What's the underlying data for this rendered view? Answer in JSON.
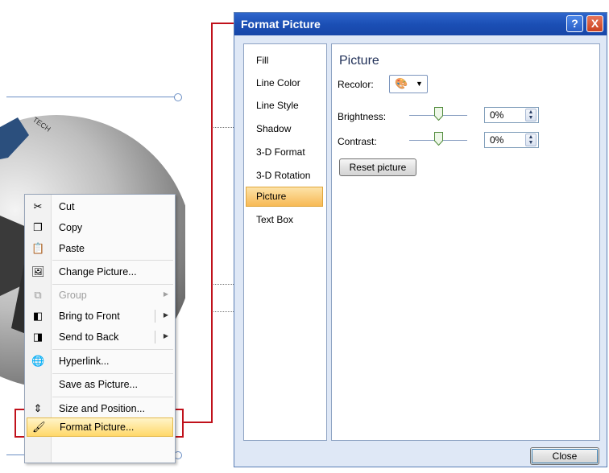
{
  "context_menu": {
    "items": [
      {
        "label": "Cut",
        "icon": "scissors-icon",
        "disabled": false
      },
      {
        "label": "Copy",
        "icon": "copy-icon",
        "disabled": false
      },
      {
        "label": "Paste",
        "icon": "paste-icon",
        "disabled": false
      },
      {
        "label": "Change Picture...",
        "icon": "change-picture-icon",
        "disabled": false
      },
      {
        "label": "Group",
        "icon": "group-icon",
        "disabled": true,
        "submenu": true
      },
      {
        "label": "Bring to Front",
        "icon": "bring-to-front-icon",
        "disabled": false,
        "submenu": true
      },
      {
        "label": "Send to Back",
        "icon": "send-to-back-icon",
        "disabled": false,
        "submenu": true
      },
      {
        "label": "Hyperlink...",
        "icon": "hyperlink-icon",
        "disabled": false
      },
      {
        "label": "Save as Picture...",
        "icon": "",
        "disabled": false
      },
      {
        "label": "Size and Position...",
        "icon": "size-position-icon",
        "disabled": false
      },
      {
        "label": "Format Picture...",
        "icon": "format-picture-icon",
        "disabled": false,
        "highlighted": true
      }
    ]
  },
  "dialog": {
    "title": "Format Picture",
    "help_label": "?",
    "close_x_label": "X",
    "nav": [
      {
        "label": "Fill"
      },
      {
        "label": "Line Color"
      },
      {
        "label": "Line Style"
      },
      {
        "label": "Shadow"
      },
      {
        "label": "3-D Format"
      },
      {
        "label": "3-D Rotation"
      },
      {
        "label": "Picture",
        "selected": true
      },
      {
        "label": "Text Box"
      }
    ],
    "section_title": "Picture",
    "recolor_label": "Recolor:",
    "brightness_label": "Brightness:",
    "brightness_value": "0%",
    "brightness_level": 0.5,
    "contrast_label": "Contrast:",
    "contrast_value": "0%",
    "contrast_level": 0.5,
    "reset_label": "Reset picture",
    "close_button_label": "Close"
  },
  "colors": {
    "callout_red": "#c0111b",
    "titlebar_blue": "#1b4fb5",
    "selection_orange": "#f7b955"
  }
}
